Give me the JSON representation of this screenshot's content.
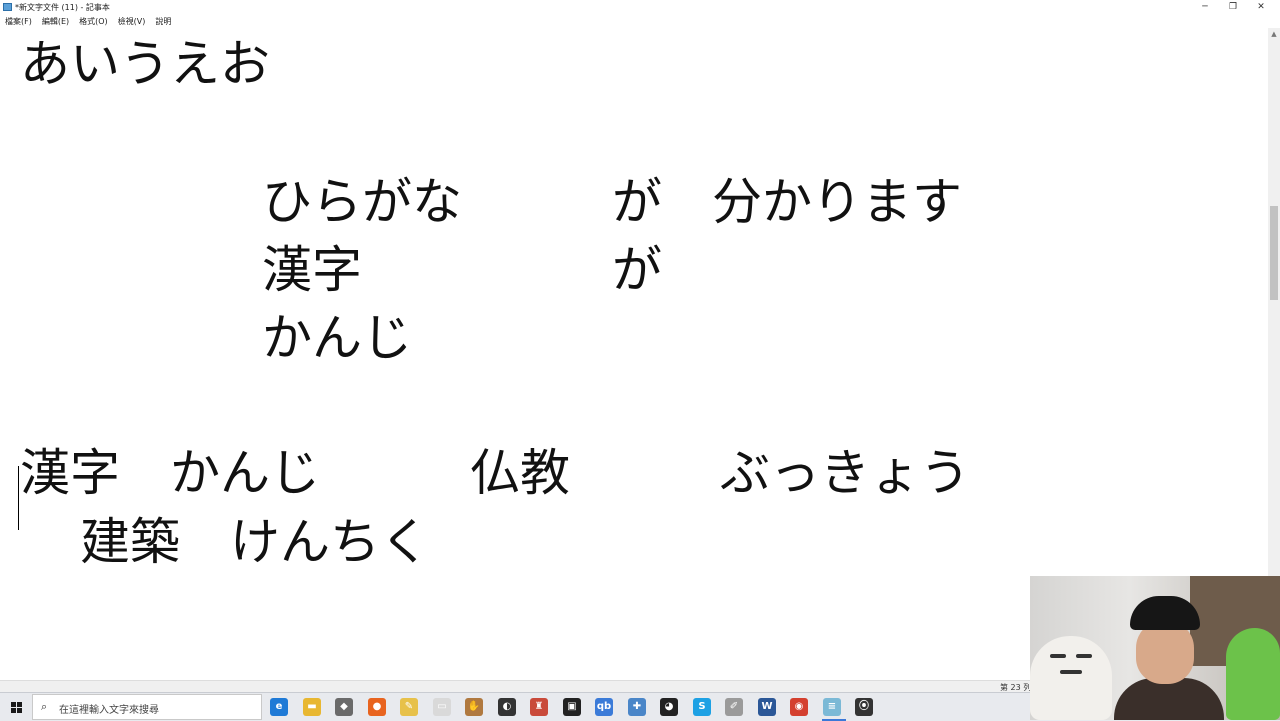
{
  "window": {
    "title": "*新文字文件 (11) - 記事本",
    "minimize": "─",
    "maximize": "❐",
    "close": "✕"
  },
  "menu": [
    "檔案(F)",
    "編輯(E)",
    "格式(O)",
    "檢視(V)",
    "說明"
  ],
  "editor": {
    "lines": [
      "あいうえお",
      "ひらがな　　　が　分かります",
      "漢字　　　　　が",
      "かんじ",
      "漢字　かんじ　　　仏教　　　ぶっきょう",
      "　建築　けんちく"
    ]
  },
  "status": {
    "position": "第 23 列"
  },
  "taskbar": {
    "search_placeholder": "在這裡輸入文字來搜尋",
    "icons": [
      {
        "name": "edge-icon",
        "glyph": "e",
        "color": "#1f7ad6"
      },
      {
        "name": "file-explorer-icon",
        "glyph": "▬",
        "color": "#e8b731"
      },
      {
        "name": "app-icon-3",
        "glyph": "◆",
        "color": "#6a6a6a"
      },
      {
        "name": "firefox-icon",
        "glyph": "●",
        "color": "#e8641f"
      },
      {
        "name": "app-icon-5",
        "glyph": "✎",
        "color": "#e7c14a"
      },
      {
        "name": "document-icon",
        "glyph": "▭",
        "color": "#d9d9d9"
      },
      {
        "name": "app-icon-7",
        "glyph": "✋",
        "color": "#b0793f"
      },
      {
        "name": "app-icon-8",
        "glyph": "◐",
        "color": "#333333"
      },
      {
        "name": "app-icon-9",
        "glyph": "♜",
        "color": "#c94a3a"
      },
      {
        "name": "line-icon",
        "glyph": "▣",
        "color": "#222222"
      },
      {
        "name": "app-icon-11",
        "glyph": "qb",
        "color": "#3b7bd8"
      },
      {
        "name": "app-icon-12",
        "glyph": "✚",
        "color": "#4a86c8"
      },
      {
        "name": "app-icon-13",
        "glyph": "◕",
        "color": "#222222"
      },
      {
        "name": "skype-icon",
        "glyph": "S",
        "color": "#1da1e4"
      },
      {
        "name": "app-icon-15",
        "glyph": "✐",
        "color": "#9a9a9a"
      },
      {
        "name": "word-icon",
        "glyph": "W",
        "color": "#2b5797"
      },
      {
        "name": "chrome-icon",
        "glyph": "◉",
        "color": "#d4402f"
      },
      {
        "name": "notepad-icon",
        "glyph": "≡",
        "color": "#7bb9d6"
      },
      {
        "name": "obs-icon",
        "glyph": "⦿",
        "color": "#333333"
      }
    ]
  }
}
